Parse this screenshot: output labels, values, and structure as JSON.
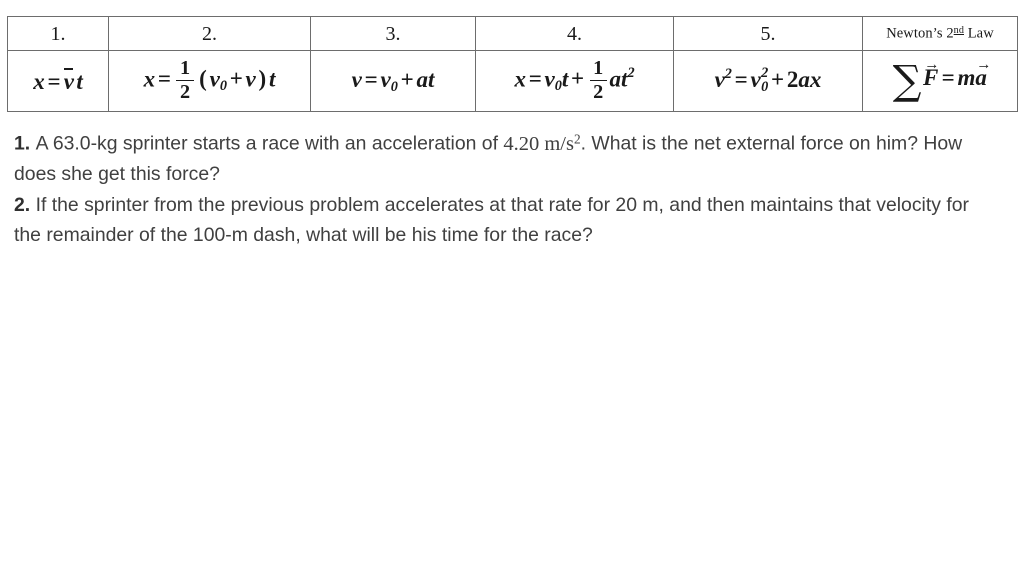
{
  "table": {
    "headers": [
      "1.",
      "2.",
      "3.",
      "4.",
      "5.",
      "Newton's 2nd Law"
    ],
    "law_header": {
      "prefix": "Newton’s ",
      "ordinal_num": "2",
      "ordinal_suffix": "nd",
      "suffix": " Law"
    },
    "equations": [
      {
        "index": "1.",
        "plain": "x = v̄ t",
        "lhs": "x",
        "equals": "=",
        "rhs_var": "v",
        "rhs_var_accent": "bar",
        "rhs_tail": "t"
      },
      {
        "index": "2.",
        "plain": "x = ½ (v₀ + v)t",
        "lhs": "x",
        "equals": "=",
        "frac_num": "1",
        "frac_den": "2",
        "open_paren": "(",
        "v0_base": "v",
        "v0_sub": "0",
        "plus": "+",
        "v": "v",
        "close_paren": ")",
        "tail": "t"
      },
      {
        "index": "3.",
        "plain": "v = v₀ + at",
        "lhs": "v",
        "equals": "=",
        "v0_base": "v",
        "v0_sub": "0",
        "plus": "+",
        "tail": "at"
      },
      {
        "index": "4.",
        "plain": "x = v₀t + ½ at²",
        "lhs": "x",
        "equals": "=",
        "v0_base": "v",
        "v0_sub": "0",
        "after_v0": "t",
        "plus": "+",
        "frac_num": "1",
        "frac_den": "2",
        "tail_base": "at",
        "tail_sup": "2"
      },
      {
        "index": "5.",
        "plain": "v² = v₀² + 2ax",
        "lhs_base": "v",
        "lhs_sup": "2",
        "equals": "=",
        "v0_base": "v",
        "v0_sub": "0",
        "v0_sup": "2",
        "plus": "+",
        "tail_coef": "2",
        "tail_vars": "ax"
      },
      {
        "index": "Newton's 2nd Law",
        "plain": "ΣF⃗ = ma⃗",
        "sigma": "∑",
        "force": "F",
        "equals": "=",
        "mass": "m",
        "accel": "a"
      }
    ]
  },
  "problems": [
    {
      "number": "1",
      "dot": ". ",
      "text_before": "A 63.0-kg sprinter starts a race with an acceleration of ",
      "value": "4.20",
      "unit_base": " m/s",
      "unit_sup": "2",
      "text_after": ". What is the net external force on him? How does she get this force?"
    },
    {
      "number": "2",
      "dot": ". ",
      "text_before": "If the sprinter from the previous problem accelerates at that rate for 20 m, and then maintains that velocity for the remainder of the 100-m dash, what will be his time for the race?",
      "value": "",
      "unit_base": "",
      "unit_sup": "",
      "text_after": ""
    }
  ],
  "colors": {
    "page_background": "#ffffff",
    "body_text": "#404040",
    "table_text": "#1a1a1a",
    "table_border": "#6d6d6d"
  }
}
